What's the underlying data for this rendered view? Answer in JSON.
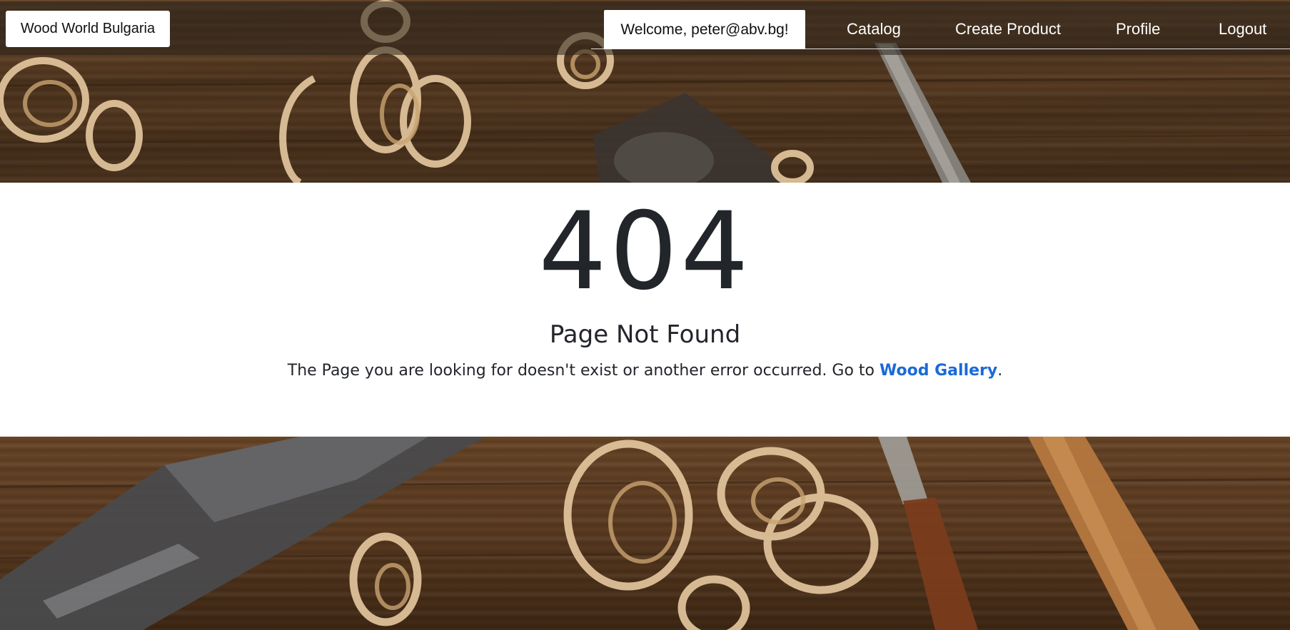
{
  "navbar": {
    "brand": "Wood World Bulgaria",
    "welcome": "Welcome, peter@abv.bg!",
    "links": {
      "catalog": "Catalog",
      "create_product": "Create Product",
      "profile": "Profile",
      "logout": "Logout"
    }
  },
  "error": {
    "code": "404",
    "title": "Page Not Found",
    "message_prefix": "The Page you are looking for doesn't exist or another error occurred. Go to ",
    "link_text": "Wood Gallery",
    "message_suffix": "."
  },
  "colors": {
    "link": "#1a6ad8",
    "text": "#22252a",
    "background_wood": "#5a3d23"
  }
}
